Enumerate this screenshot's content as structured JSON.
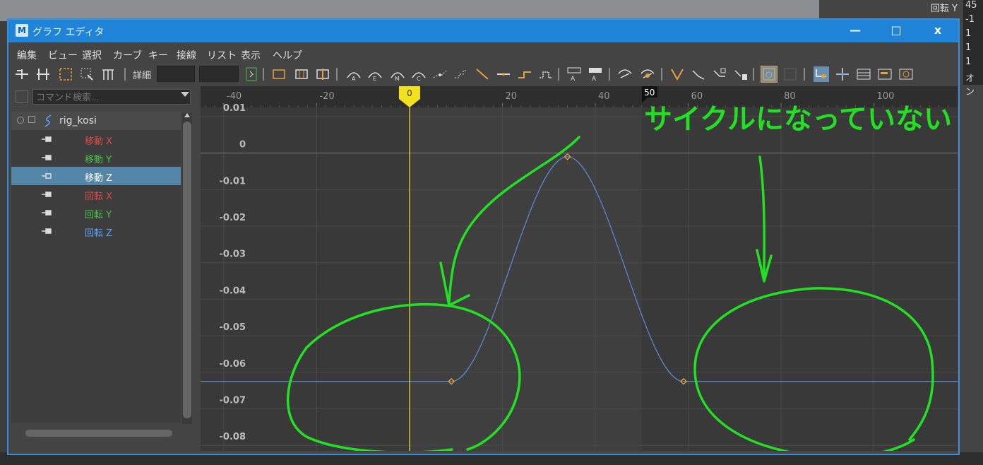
{
  "background": {
    "attributes": [
      {
        "label": "回転 Y",
        "value": "45"
      },
      {
        "label": "",
        "value": "-1"
      },
      {
        "label": "",
        "value": "1"
      },
      {
        "label": "",
        "value": "1"
      },
      {
        "label": "",
        "value": "1"
      },
      {
        "label": "",
        "value": "オン"
      }
    ]
  },
  "window": {
    "title": "グラフ エディタ",
    "app_icon": "M",
    "minimize": "—",
    "maximize": "□",
    "close": "x"
  },
  "menu": [
    "編集",
    "ビュー",
    "選択",
    "カーブ",
    "キー",
    "接線",
    "リスト",
    "表示",
    "ヘルプ"
  ],
  "toolbar": {
    "detail_label": "詳細",
    "field1_value": "",
    "field2_value": ""
  },
  "outliner": {
    "search_placeholder": "コマンド検索...",
    "root": "rig_kosi",
    "channels": [
      {
        "label": "移動 X",
        "color": "#e04a4a",
        "selected": false
      },
      {
        "label": "移動 Y",
        "color": "#49c449",
        "selected": false
      },
      {
        "label": "移動 Z",
        "color": "#ffffff",
        "selected": true
      },
      {
        "label": "回転 X",
        "color": "#e04a4a",
        "selected": false
      },
      {
        "label": "回転 Y",
        "color": "#49c449",
        "selected": false
      },
      {
        "label": "回転 Z",
        "color": "#5aa0ff",
        "selected": false
      }
    ]
  },
  "graph": {
    "current_frame": "0",
    "end_marker": "50",
    "annotation": "サイクルになっていない"
  },
  "chart_data": {
    "type": "line",
    "x_ticks": [
      -40,
      -20,
      0,
      20,
      40,
      50,
      60,
      80,
      100
    ],
    "y_ticks": [
      0.01,
      0,
      -0.01,
      -0.02,
      -0.03,
      -0.04,
      -0.05,
      -0.06,
      -0.07,
      -0.08
    ],
    "y_tick_labels": [
      "0.01",
      "0",
      "-0.01",
      "-0.02",
      "-0.03",
      "-0.04",
      "-0.05",
      "-0.06",
      "-0.07",
      "-0.08"
    ],
    "xlim": [
      -45,
      118
    ],
    "ylim": [
      -0.0815,
      0.0125
    ],
    "series": [
      {
        "color": "#5b8fd8",
        "keys": [
          {
            "x": 9,
            "y": -0.0625
          },
          {
            "x": 34,
            "y": -0.001
          },
          {
            "x": 59,
            "y": -0.0625
          }
        ],
        "pre_infinity": -0.0625,
        "post_infinity": -0.0625
      }
    ],
    "current_time": 0,
    "range_end": 50
  },
  "colors": {
    "accent": "#1f84d8",
    "annotation": "#22e022",
    "time_marker": "#f2e21d"
  }
}
